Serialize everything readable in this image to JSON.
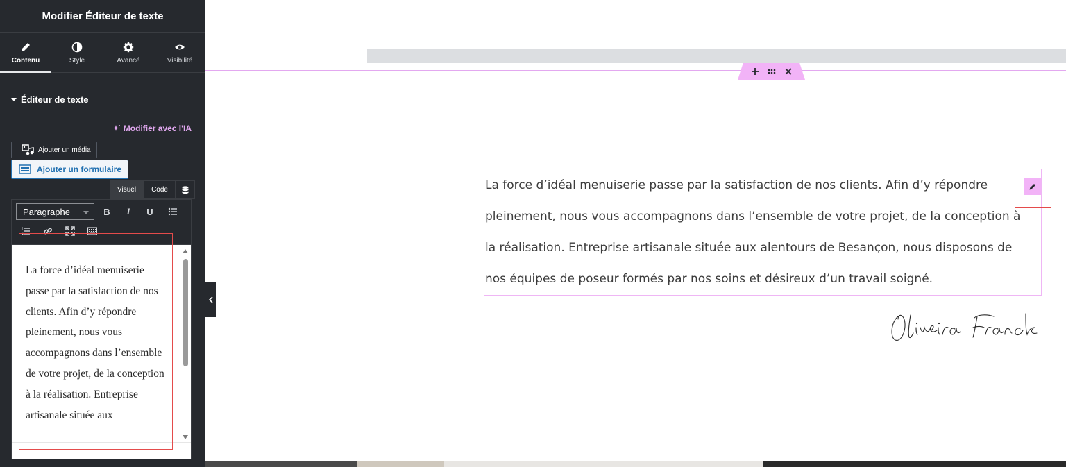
{
  "panel": {
    "title": "Modifier Éditeur de texte",
    "tabs": [
      {
        "label": "Contenu",
        "icon": "pencil-icon",
        "active": true
      },
      {
        "label": "Style",
        "icon": "half-circle-icon"
      },
      {
        "label": "Avancé",
        "icon": "gear-icon"
      },
      {
        "label": "Visibilité",
        "icon": "eye-icon"
      }
    ],
    "section_title": "Éditeur de texte",
    "ai_link": "Modifier avec l'IA",
    "add_media": "Ajouter un média",
    "add_form": "Ajouter un formulaire",
    "editor_tabs": {
      "visual": "Visuel",
      "code": "Code"
    },
    "format_select": "Paragraphe",
    "toolbar": {
      "bold": "B",
      "italic": "I",
      "underline": "U"
    },
    "editor_text": "La force d’idéal menuiserie passe par la satisfaction de nos clients. Afin d’y répondre pleinement, nous vous accompagnons dans l’ensemble de votre projet, de la conception à la réalisation. Entreprise artisanale située aux"
  },
  "canvas": {
    "paragraph": "La force d’idéal menuiserie passe par la satisfaction de nos clients. Afin d’y répondre pleinement, nous vous accompagnons dans l’ensemble de votre projet, de la conception à la réalisation. Entreprise artisanale située aux alentours de Besançon, nous disposons de nos équipes de poseur formés par nos soins et désireux d’un travail soigné.",
    "signature": "Oliveira Franck"
  },
  "colors": {
    "panel_bg": "#26292e",
    "accent_pink": "#f2b3f7",
    "ai_link": "#e2a8f0",
    "form_blue": "#2271b1",
    "highlight_red": "#e44b4b"
  }
}
